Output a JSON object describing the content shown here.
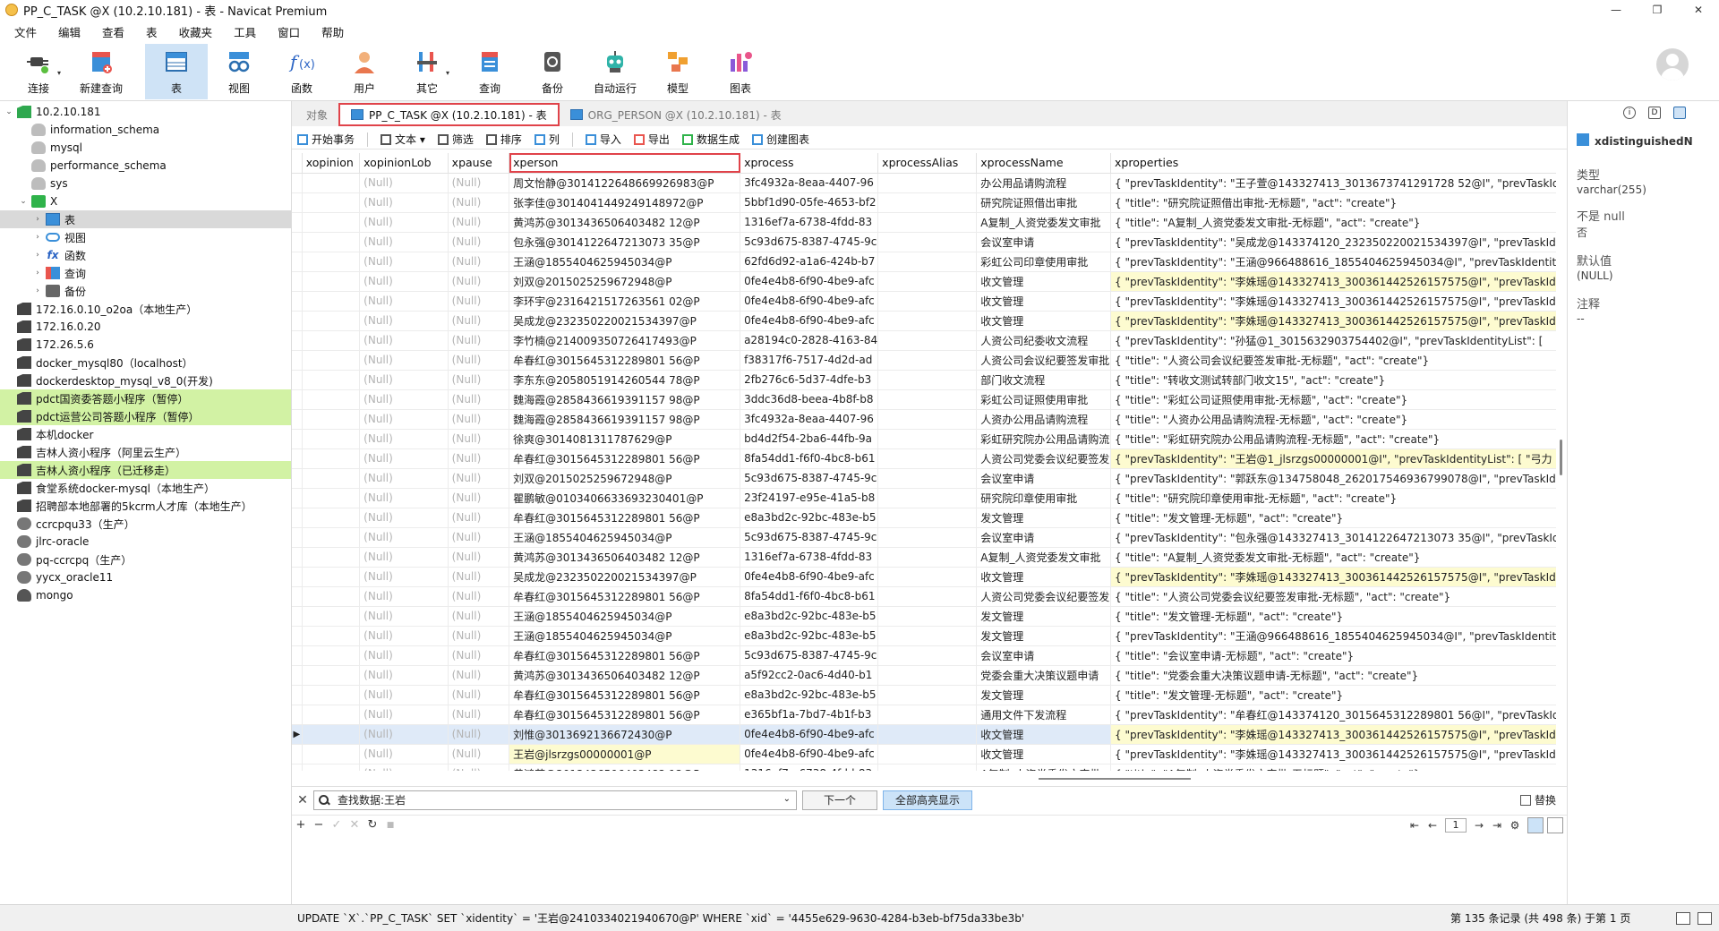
{
  "window": {
    "title": "PP_C_TASK @X (10.2.10.181) - 表 - Navicat Premium",
    "controls": [
      "—",
      "❐",
      "✕"
    ]
  },
  "menu": [
    "文件",
    "编辑",
    "查看",
    "表",
    "收藏夹",
    "工具",
    "窗口",
    "帮助"
  ],
  "toolbar": [
    {
      "label": "连接",
      "icon": "connect-plug-icon",
      "dropdown": "▾"
    },
    {
      "label": "新建查询",
      "icon": "new-query-icon"
    },
    {
      "label": "表",
      "icon": "table-icon",
      "active": true
    },
    {
      "label": "视图",
      "icon": "view-glasses-icon"
    },
    {
      "label": "函数",
      "icon": "function-fx-icon"
    },
    {
      "label": "用户",
      "icon": "user-icon"
    },
    {
      "label": "其它",
      "icon": "tools-icon",
      "dropdown": "▾"
    },
    {
      "label": "查询",
      "icon": "query-icon"
    },
    {
      "label": "备份",
      "icon": "backup-icon"
    },
    {
      "label": "自动运行",
      "icon": "robot-icon"
    },
    {
      "label": "模型",
      "icon": "model-icon"
    },
    {
      "label": "图表",
      "icon": "chart-icon"
    }
  ],
  "tree": [
    {
      "label": "10.2.10.181",
      "icon": "connok",
      "level": 0,
      "exp": "⌄"
    },
    {
      "label": "information_schema",
      "icon": "db",
      "level": 1
    },
    {
      "label": "mysql",
      "icon": "db",
      "level": 1
    },
    {
      "label": "performance_schema",
      "icon": "db",
      "level": 1
    },
    {
      "label": "sys",
      "icon": "db",
      "level": 1
    },
    {
      "label": "X",
      "icon": "green",
      "level": 1,
      "exp": "⌄"
    },
    {
      "label": "表",
      "icon": "tbl",
      "level": 2,
      "exp": "›",
      "selected": true
    },
    {
      "label": "视图",
      "icon": "view",
      "level": 2,
      "exp": "›"
    },
    {
      "label": "函数",
      "icon": "fx",
      "level": 2,
      "exp": "›"
    },
    {
      "label": "查询",
      "icon": "qry",
      "level": 2,
      "exp": "›"
    },
    {
      "label": "备份",
      "icon": "bak",
      "level": 2,
      "exp": "›"
    },
    {
      "label": "172.16.0.10_o2oa（本地生产）",
      "icon": "conn",
      "level": 0
    },
    {
      "label": "172.16.0.20",
      "icon": "conn",
      "level": 0
    },
    {
      "label": "172.26.5.6",
      "icon": "conn",
      "level": 0
    },
    {
      "label": "docker_mysql80（localhost）",
      "icon": "conn",
      "level": 0
    },
    {
      "label": "dockerdesktop_mysql_v8_0(开发)",
      "icon": "conn",
      "level": 0
    },
    {
      "label": "pdct国资委答题小程序（暂停）",
      "icon": "conn",
      "level": 0,
      "green": true
    },
    {
      "label": "pdct运营公司答题小程序（暂停）",
      "icon": "conn",
      "level": 0,
      "green": true
    },
    {
      "label": "本机docker",
      "icon": "conn",
      "level": 0
    },
    {
      "label": "吉林人资小程序（阿里云生产）",
      "icon": "conn",
      "level": 0
    },
    {
      "label": "吉林人资小程序（已迁移走）",
      "icon": "conn",
      "level": 0,
      "green": true
    },
    {
      "label": "食堂系统docker-mysql（本地生产）",
      "icon": "conn",
      "level": 0
    },
    {
      "label": "招聘部本地部署的5kcrm人才库（本地生产）",
      "icon": "conn",
      "level": 0
    },
    {
      "label": "ccrcpqu33（生产）",
      "icon": "ora",
      "level": 0
    },
    {
      "label": "jlrc-oracle",
      "icon": "ora",
      "level": 0
    },
    {
      "label": "pq-ccrcpq（生产）",
      "icon": "ora",
      "level": 0
    },
    {
      "label": "yycx_oracle11",
      "icon": "ora",
      "level": 0
    },
    {
      "label": "mongo",
      "icon": "mongo",
      "level": 0
    }
  ],
  "tabs": [
    {
      "label": "对象",
      "active": false,
      "icon": false
    },
    {
      "label": "PP_C_TASK @X (10.2.10.181) - 表",
      "active": true,
      "icon": true
    },
    {
      "label": "ORG_PERSON @X (10.2.10.181) - 表",
      "active": false,
      "icon": true
    }
  ],
  "grid_toolbar": [
    {
      "label": "开始事务",
      "icon": "transaction-icon",
      "sep": true
    },
    {
      "label": "文本 ▾",
      "icon": "text-icon"
    },
    {
      "label": "筛选",
      "icon": "filter-icon"
    },
    {
      "label": "排序",
      "icon": "sort-icon"
    },
    {
      "label": "列",
      "icon": "columns-icon",
      "sep": true
    },
    {
      "label": "导入",
      "icon": "import-icon"
    },
    {
      "label": "导出",
      "icon": "export-icon"
    },
    {
      "label": "数据生成",
      "icon": "data-generate-icon"
    },
    {
      "label": "创建图表",
      "icon": "create-chart-icon"
    }
  ],
  "columns": [
    "xopinion",
    "xopinionLob",
    "xpause",
    "xperson",
    "xprocess",
    "xprocessAlias",
    "xprocessName",
    "xproperties"
  ],
  "rows": [
    {
      "person": "周文怡静@3014122648669926983@P",
      "process": "3fc4932a-8eaa-4407-96",
      "name": "办公用品请购流程",
      "props": "{  \"prevTaskIdentity\": \"王子萱@143327413_3013673741291728 52@I\",  \"prevTaskIde",
      "ylw": false
    },
    {
      "person": "张李佳@3014041449249148972@P",
      "process": "5bbf1d90-05fe-4653-bf2",
      "name": "研究院证照借出审批",
      "props": "{  \"title\": \"研究院证照借出审批-无标题\",  \"act\": \"create\"}",
      "ylw": false
    },
    {
      "person": "黄鸿苏@3013436506403482 12@P",
      "process": "1316ef7a-6738-4fdd-83",
      "name": "A复制_人资党委发文审批",
      "props": "{  \"title\": \"A复制_人资党委发文审批-无标题\",  \"act\": \"create\"}",
      "ylw": false
    },
    {
      "person": "包永强@3014122647213073 35@P",
      "process": "5c93d675-8387-4745-9c",
      "name": "会议室申请",
      "props": "{  \"prevTaskIdentity\": \"吴成龙@143374120_232350220021534397@I\",  \"prevTaskIde",
      "ylw": false
    },
    {
      "person": "王涵@1855404625945034@P",
      "process": "62fd6d92-a1a6-424b-b7",
      "name": "彩虹公司印章使用审批",
      "props": "{  \"prevTaskIdentity\": \"王涵@966488616_1855404625945034@I\",  \"prevTaskIdentity",
      "ylw": false
    },
    {
      "person": "刘双@2015025259672948@P",
      "process": "0fe4e4b8-6f90-4be9-afc",
      "name": "收文管理",
      "props": "{  \"prevTaskIdentity\": \"李姝瑶@143327413_300361442526157575@I\",  \"prevTaskIde",
      "ylw": true
    },
    {
      "person": "李环宇@2316421517263561 02@P",
      "process": "0fe4e4b8-6f90-4be9-afc",
      "name": "收文管理",
      "props": "{  \"prevTaskIdentity\": \"李姝瑶@143327413_300361442526157575@I\",  \"prevTaskIde",
      "ylw": false
    },
    {
      "person": "吴成龙@232350220021534397@P",
      "process": "0fe4e4b8-6f90-4be9-afc",
      "name": "收文管理",
      "props": "{  \"prevTaskIdentity\": \"李姝瑶@143327413_300361442526157575@I\",  \"prevTaskIde",
      "ylw": true
    },
    {
      "person": "李竹楠@214009350726417493@P",
      "process": "a28194c0-2828-4163-84",
      "name": "人资公司纪委收文流程",
      "props": "{  \"prevTaskIdentity\": \"孙猛@1_3015632903754402@I\",  \"prevTaskIdentityList\": [  ",
      "ylw": false
    },
    {
      "person": "牟春红@3015645312289801 56@P",
      "process": "f38317f6-7517-4d2d-ad",
      "name": "人资公司会议纪要签发审批",
      "props": "{  \"title\": \"人资公司会议纪要签发审批-无标题\",  \"act\": \"create\"}",
      "ylw": false
    },
    {
      "person": "李东东@2058051914260544 78@P",
      "process": "2fb276c6-5d37-4dfe-b3",
      "name": "部门收文流程",
      "props": "{  \"title\": \"转收文测试转部门收文15\",  \"act\": \"create\"}",
      "ylw": false
    },
    {
      "person": "魏海霞@2858436619391157 98@P",
      "process": "3ddc36d8-beea-4b8f-b8",
      "name": "彩虹公司证照使用审批",
      "props": "{  \"title\": \"彩虹公司证照使用审批-无标题\",  \"act\": \"create\"}",
      "ylw": false
    },
    {
      "person": "魏海霞@2858436619391157 98@P",
      "process": "3fc4932a-8eaa-4407-96",
      "name": "人资办公用品请购流程",
      "props": "{  \"title\": \"人资办公用品请购流程-无标题\",  \"act\": \"create\"}",
      "ylw": false
    },
    {
      "person": "徐爽@3014081311787629@P",
      "process": "bd4d2f54-2ba6-44fb-9a",
      "name": "彩虹研究院办公用品请购流",
      "props": "{  \"title\": \"彩虹研究院办公用品请购流程-无标题\",  \"act\": \"create\"}",
      "ylw": false
    },
    {
      "person": "牟春红@3015645312289801 56@P",
      "process": "8fa54dd1-f6f0-4bc8-b61",
      "name": "人资公司党委会议纪要签发",
      "props": "{  \"prevTaskIdentity\": \"王岩@1_jlsrzgs00000001@I\",  \"prevTaskIdentityList\": [  \"弓力",
      "ylw": true
    },
    {
      "person": "刘双@2015025259672948@P",
      "process": "5c93d675-8387-4745-9c",
      "name": "会议室申请",
      "props": "{  \"prevTaskIdentity\": \"郭跃东@134758048_262017546936799078@I\",  \"prevTaskIde",
      "ylw": false
    },
    {
      "person": "瞿鹏敏@0103406633693230401@P",
      "process": "23f24197-e95e-41a5-b8",
      "name": "研究院印章使用审批",
      "props": "{  \"title\": \"研究院印章使用审批-无标题\",  \"act\": \"create\"}",
      "ylw": false
    },
    {
      "person": "牟春红@3015645312289801 56@P",
      "process": "e8a3bd2c-92bc-483e-b5",
      "name": "发文管理",
      "props": "{  \"title\": \"发文管理-无标题\",  \"act\": \"create\"}",
      "ylw": false
    },
    {
      "person": "王涵@1855404625945034@P",
      "process": "5c93d675-8387-4745-9c",
      "name": "会议室申请",
      "props": "{  \"prevTaskIdentity\": \"包永强@143327413_3014122647213073 35@I\",  \"prevTaskIde",
      "ylw": false
    },
    {
      "person": "黄鸿苏@3013436506403482 12@P",
      "process": "1316ef7a-6738-4fdd-83",
      "name": "A复制_人资党委发文审批",
      "props": "{  \"title\": \"A复制_人资党委发文审批-无标题\",  \"act\": \"create\"}",
      "ylw": false
    },
    {
      "person": "吴成龙@232350220021534397@P",
      "process": "0fe4e4b8-6f90-4be9-afc",
      "name": "收文管理",
      "props": "{  \"prevTaskIdentity\": \"李姝瑶@143327413_300361442526157575@I\",  \"prevTaskIde",
      "ylw": true
    },
    {
      "person": "牟春红@3015645312289801 56@P",
      "process": "8fa54dd1-f6f0-4bc8-b61",
      "name": "人资公司党委会议纪要签发",
      "props": "{  \"title\": \"人资公司党委会议纪要签发审批-无标题\",  \"act\": \"create\"}",
      "ylw": false
    },
    {
      "person": "王涵@1855404625945034@P",
      "process": "e8a3bd2c-92bc-483e-b5",
      "name": "发文管理",
      "props": "{  \"title\": \"发文管理-无标题\",  \"act\": \"create\"}",
      "ylw": false
    },
    {
      "person": "王涵@1855404625945034@P",
      "process": "e8a3bd2c-92bc-483e-b5",
      "name": "发文管理",
      "props": "{  \"prevTaskIdentity\": \"王涵@966488616_1855404625945034@I\",  \"prevTaskIdentity",
      "ylw": false
    },
    {
      "person": "牟春红@3015645312289801 56@P",
      "process": "5c93d675-8387-4745-9c",
      "name": "会议室申请",
      "props": "{  \"title\": \"会议室申请-无标题\",  \"act\": \"create\"}",
      "ylw": false
    },
    {
      "person": "黄鸿苏@3013436506403482 12@P",
      "process": "a5f92cc2-0ac6-4d40-b1",
      "name": "党委会重大决策议题申请",
      "props": "{  \"title\": \"党委会重大决策议题申请-无标题\",  \"act\": \"create\"}",
      "ylw": false
    },
    {
      "person": "牟春红@3015645312289801 56@P",
      "process": "e8a3bd2c-92bc-483e-b5",
      "name": "发文管理",
      "props": "{  \"title\": \"发文管理-无标题\",  \"act\": \"create\"}",
      "ylw": false
    },
    {
      "person": "牟春红@3015645312289801 56@P",
      "process": "e365bf1a-7bd7-4b1f-b3",
      "name": "通用文件下发流程",
      "props": "{  \"prevTaskIdentity\": \"牟春红@143374120_3015645312289801 56@I\",  \"prevTaskIde",
      "ylw": false
    },
    {
      "person": "刘惟@3013692136672430@P",
      "process": "0fe4e4b8-6f90-4be9-afc",
      "name": "收文管理",
      "props": "{  \"prevTaskIdentity\": \"李姝瑶@143327413_300361442526157575@I\",  \"prevTaskIde",
      "ylw": true,
      "current": true
    },
    {
      "person": "王岩@jlsrzgs00000001@P",
      "process": "0fe4e4b8-6f90-4be9-afc",
      "name": "收文管理",
      "props": "{  \"prevTaskIdentity\": \"李姝瑶@143327413_300361442526157575@I\",  \"prevTaskIde",
      "ylw": false,
      "personYlw": true
    },
    {
      "person": "黄鸿苏@3013436506403482 12@P",
      "process": "1316ef7a-6738-4fdd-83",
      "name": "A复制_人资党委发文审批",
      "props": "{  \"title\": \"A复制_人资党委发文审批-无标题\",  \"act\": \"create\"}",
      "ylw": false
    },
    {
      "person": "徐爽@3014081311787629@P",
      "process": "f23e0aa9-89a5-4431-87",
      "name": "办公用品领用流程",
      "props": "{  \"title\": \"办公用品领用流程-无标题\",  \"act\": \"create\"}",
      "ylw": false
    },
    {
      "person": "黄鸿苏@3013436506403482 12@P",
      "process": "1316ef7a-6738-4fdd-83",
      "name": "A复制_人资党委发文审批",
      "props": "{  \"title\": \"A复制_人资党委发文审批-无标题\",  \"act\": \"create\"}",
      "ylw": false
    }
  ],
  "null_text": "(Null)",
  "find": {
    "value": "查找数据:王岩",
    "next_label": "下一个",
    "highlight_all_label": "全部高亮显示",
    "replace_label": "替换"
  },
  "nav": {
    "add": "+",
    "remove": "−",
    "apply": "✓",
    "cancel": "✕",
    "refresh": "↻",
    "stop": "■",
    "first": "⇤",
    "prev": "←",
    "page": "1",
    "next": "→",
    "last": "⇥",
    "settings": "⚙"
  },
  "right_panel": {
    "field_name": "xdistinguishedN",
    "type_label": "类型",
    "type_value": "varchar(255)",
    "notnull_label": "不是 null",
    "notnull_value": "否",
    "default_label": "默认值",
    "default_value": "(NULL)",
    "comment_label": "注释",
    "comment_value": "--"
  },
  "status": {
    "sql": "UPDATE `X`.`PP_C_TASK` SET `xidentity` = '王岩@2410334021940670@P' WHERE `xid` = '4455e629-9630-4284-b3eb-bf75da33be3b'",
    "record_info": "第 135 条记录 (共 498 条) 于第 1 页"
  },
  "colors": {
    "accent": "#e0434a",
    "selected_tab": "#cfe3f6",
    "green_row": "#d2f2a4",
    "yellow_cell": "#fdfbd0",
    "current_row": "#dfeaf8"
  }
}
